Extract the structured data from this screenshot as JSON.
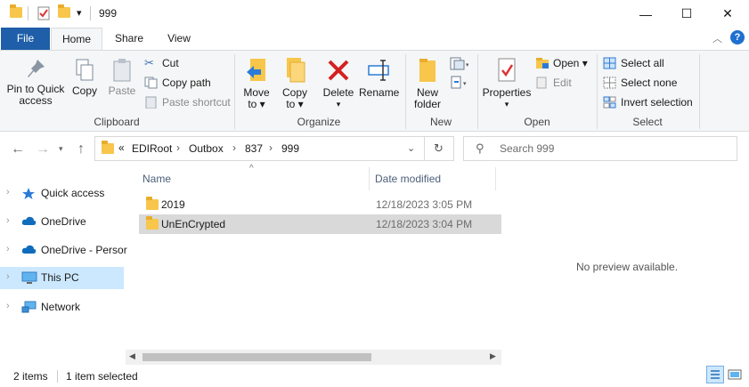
{
  "window": {
    "title": "999",
    "controls": {
      "minimize": "—",
      "maximize": "☐",
      "close": "✕"
    }
  },
  "ribbon_tabs": [
    "File",
    "Home",
    "Share",
    "View"
  ],
  "ribbon": {
    "clipboard": {
      "label": "Clipboard",
      "pin_line1": "Pin to Quick",
      "pin_line2": "access",
      "copy": "Copy",
      "paste": "Paste",
      "cut": "Cut",
      "copy_path": "Copy path",
      "paste_shortcut": "Paste shortcut"
    },
    "organize": {
      "label": "Organize",
      "move_to_1": "Move",
      "move_to_2": "to ▾",
      "copy_to_1": "Copy",
      "copy_to_2": "to ▾",
      "delete": "Delete",
      "rename": "Rename"
    },
    "new": {
      "label": "New",
      "new_folder_1": "New",
      "new_folder_2": "folder"
    },
    "open": {
      "label": "Open",
      "properties": "Properties",
      "open": "Open ▾",
      "edit": "Edit"
    },
    "select": {
      "label": "Select",
      "select_all": "Select all",
      "select_none": "Select none",
      "invert": "Invert selection"
    }
  },
  "address": {
    "overflow": "«",
    "crumbs": [
      "EDIRoot",
      "Outbox",
      "837",
      "999"
    ],
    "search_placeholder": "Search 999"
  },
  "nav_pane": [
    {
      "label": "Quick access",
      "icon": "star-icon"
    },
    {
      "label": "OneDrive",
      "icon": "cloud-icon"
    },
    {
      "label": "OneDrive - Persor",
      "icon": "cloud-icon"
    },
    {
      "label": "This PC",
      "icon": "computer-icon",
      "selected": true
    },
    {
      "label": "Network",
      "icon": "network-icon"
    }
  ],
  "file_list": {
    "columns": [
      "Name",
      "Date modified"
    ],
    "rows": [
      {
        "name": "2019",
        "date": "12/18/2023 3:05 PM"
      },
      {
        "name": "UnEnCrypted",
        "date": "12/18/2023 3:04 PM",
        "selected": true
      }
    ]
  },
  "preview_text": "No preview available.",
  "status": {
    "items": "2 items",
    "selected": "1 item selected"
  },
  "colors": {
    "accent": "#1f5ea8",
    "selection": "#cce8ff",
    "folder": "#f7c64b"
  }
}
